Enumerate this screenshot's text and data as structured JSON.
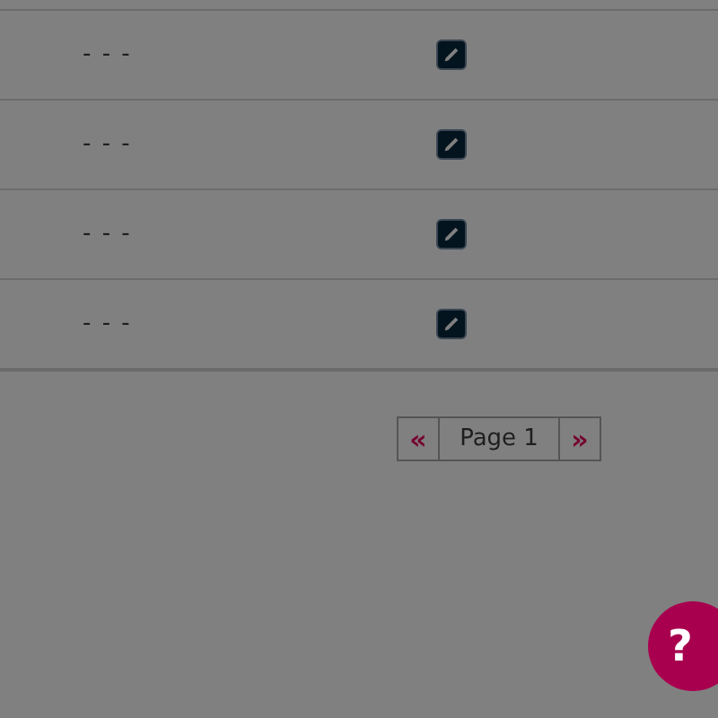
{
  "table": {
    "rows": [
      {
        "value": "- - -"
      },
      {
        "value": "- - -"
      },
      {
        "value": "- - -"
      },
      {
        "value": "- - -"
      }
    ]
  },
  "pagination": {
    "previous": "«",
    "page": "Page 1",
    "next": "»"
  },
  "help_button": {
    "label": "?"
  }
}
